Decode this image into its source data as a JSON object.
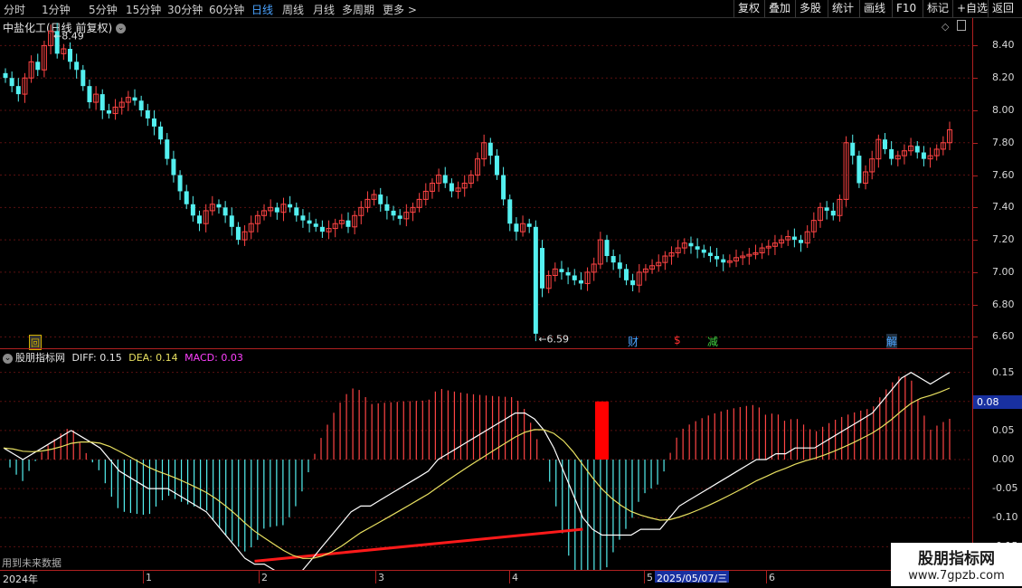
{
  "toolbar": {
    "periods": [
      "分时",
      "1分钟",
      "5分钟",
      "15分钟",
      "30分钟",
      "60分钟",
      "日线",
      "周线",
      "月线",
      "多周期",
      "更多 >"
    ],
    "active_period": "日线",
    "buttons": [
      "复权",
      "叠加",
      "多股",
      "统计",
      "画线",
      "F10",
      "标记",
      "+自选",
      "返回"
    ]
  },
  "main_panel": {
    "title": "中盐化工(日线 前复权)",
    "price_ticks": [
      "8.40",
      "8.20",
      "8.00",
      "7.80",
      "7.60",
      "7.40",
      "7.20",
      "7.00",
      "6.80",
      "6.60"
    ],
    "high_label": "8.49",
    "low_label": "6.59",
    "markers": [
      {
        "text": "回",
        "color": "#d0b000"
      },
      {
        "text": "财",
        "color": "#4aa3ff"
      },
      {
        "text": "$",
        "color": "#ff3030"
      },
      {
        "text": "减",
        "color": "#40d040"
      },
      {
        "text": "解",
        "color": "#4aa3ff"
      }
    ]
  },
  "indicator_panel": {
    "name": "股朋指标网",
    "diff_label": "DIFF: 0.15",
    "dea_label": "DEA: 0.14",
    "macd_label": "MACD: 0.03",
    "current_value": "0.08",
    "ticks": [
      "0.15",
      "0.10",
      "0.05",
      "0.00",
      "-0.05",
      "-0.10",
      "-0.15"
    ],
    "footnote": "用到未来数据"
  },
  "date_axis": {
    "year": "2024年",
    "months": [
      "1",
      "2",
      "3",
      "4",
      "5",
      "6"
    ],
    "cursor_date": "2025/05/07/三"
  },
  "watermark": {
    "title": "股朋指标网",
    "url": "www.7gpzb.com"
  },
  "colors": {
    "up": "#ff4444",
    "down": "#54f0f0",
    "diff_line": "#ffffff",
    "dea_line": "#e8e060",
    "macd_label": "#ff40ff",
    "trend_line": "#ff1a1a"
  },
  "chart_data": {
    "type": "candlestick",
    "title": "中盐化工(日线 前复权)",
    "y_range": [
      6.53,
      8.57
    ],
    "close_prices": [
      8.2,
      8.15,
      8.1,
      8.2,
      8.3,
      8.25,
      8.4,
      8.49,
      8.35,
      8.38,
      8.3,
      8.25,
      8.15,
      8.05,
      8.1,
      8.0,
      7.98,
      8.02,
      8.05,
      8.08,
      8.06,
      8.0,
      7.95,
      7.9,
      7.82,
      7.7,
      7.6,
      7.5,
      7.42,
      7.35,
      7.3,
      7.38,
      7.42,
      7.4,
      7.35,
      7.28,
      7.2,
      7.25,
      7.3,
      7.35,
      7.38,
      7.4,
      7.37,
      7.42,
      7.4,
      7.35,
      7.32,
      7.3,
      7.28,
      7.25,
      7.27,
      7.3,
      7.32,
      7.28,
      7.35,
      7.4,
      7.45,
      7.48,
      7.42,
      7.38,
      7.35,
      7.33,
      7.37,
      7.4,
      7.45,
      7.5,
      7.55,
      7.6,
      7.55,
      7.5,
      7.52,
      7.55,
      7.6,
      7.7,
      7.8,
      7.72,
      7.6,
      7.45,
      7.3,
      7.25,
      7.3,
      7.28,
      6.62,
      6.9,
      6.98,
      7.02,
      7.0,
      6.98,
      6.95,
      6.93,
      7.0,
      7.05,
      7.2,
      7.1,
      7.06,
      7.02,
      6.95,
      6.92,
      7.0,
      7.02,
      7.04,
      7.06,
      7.1,
      7.12,
      7.15,
      7.18,
      7.16,
      7.14,
      7.12,
      7.1,
      7.08,
      7.06,
      7.07,
      7.09,
      7.1,
      7.11,
      7.12,
      7.15,
      7.16,
      7.18,
      7.2,
      7.22,
      7.2,
      7.18,
      7.25,
      7.32,
      7.4,
      7.38,
      7.35,
      7.45,
      7.8,
      7.72,
      7.55,
      7.62,
      7.7,
      7.82,
      7.76,
      7.7,
      7.72,
      7.75,
      7.78,
      7.74,
      7.7,
      7.72,
      7.76,
      7.8,
      7.88
    ],
    "diff": [
      0.02,
      0.01,
      0.0,
      0.01,
      0.02,
      0.03,
      0.04,
      0.05,
      0.04,
      0.03,
      0.02,
      0.0,
      -0.02,
      -0.03,
      -0.04,
      -0.05,
      -0.05,
      -0.05,
      -0.06,
      -0.07,
      -0.08,
      -0.09,
      -0.11,
      -0.13,
      -0.15,
      -0.17,
      -0.18,
      -0.18,
      -0.19,
      -0.2,
      -0.2,
      -0.19,
      -0.17,
      -0.15,
      -0.13,
      -0.11,
      -0.09,
      -0.08,
      -0.08,
      -0.07,
      -0.06,
      -0.05,
      -0.04,
      -0.03,
      -0.02,
      0.0,
      0.01,
      0.02,
      0.03,
      0.04,
      0.05,
      0.06,
      0.07,
      0.08,
      0.08,
      0.07,
      0.05,
      0.02,
      -0.02,
      -0.06,
      -0.1,
      -0.12,
      -0.13,
      -0.13,
      -0.13,
      -0.13,
      -0.12,
      -0.12,
      -0.12,
      -0.1,
      -0.08,
      -0.07,
      -0.06,
      -0.05,
      -0.04,
      -0.03,
      -0.02,
      -0.01,
      0.0,
      0.0,
      0.01,
      0.01,
      0.02,
      0.02,
      0.02,
      0.03,
      0.04,
      0.05,
      0.06,
      0.07,
      0.08,
      0.1,
      0.12,
      0.14,
      0.15,
      0.14,
      0.13,
      0.14,
      0.15
    ]
  }
}
